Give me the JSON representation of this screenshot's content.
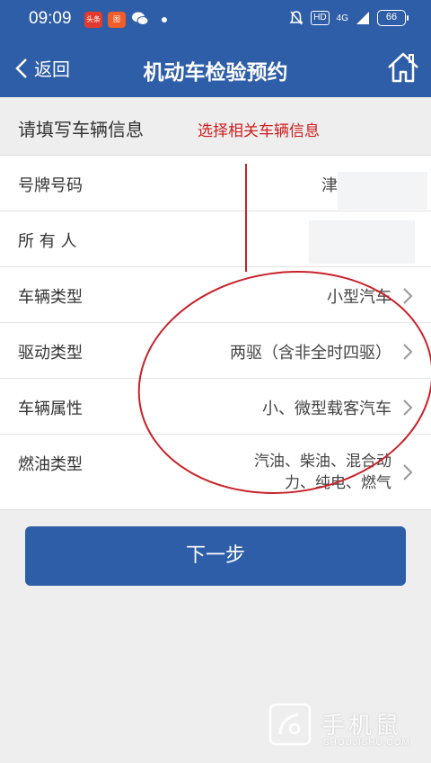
{
  "status_bar": {
    "time": "09:09",
    "app1": "头条",
    "app2": "图",
    "hd": "HD",
    "network": "4G",
    "battery": "66"
  },
  "nav": {
    "back_label": "返回",
    "title": "机动车检验预约"
  },
  "section": {
    "title": "请填写车辆信息",
    "annotation": "选择相关车辆信息"
  },
  "form": {
    "rows": [
      {
        "label": "号牌号码",
        "value": "津"
      },
      {
        "label": "所 有 人",
        "value": ""
      },
      {
        "label": "车辆类型",
        "value": "小型汽车"
      },
      {
        "label": "驱动类型",
        "value": "两驱（含非全时四驱）"
      },
      {
        "label": "车辆属性",
        "value": "小、微型载客汽车"
      },
      {
        "label": "燃油类型",
        "value_line1": "汽油、柴油、混合动",
        "value_line2": "力、纯电、燃气"
      }
    ]
  },
  "next_button": {
    "label": "下一步"
  },
  "watermark": {
    "brand": "手机鼠",
    "url": "SHOUJISHU.COM"
  },
  "colors": {
    "primary": "#2f5ea8",
    "annotation_red": "#d01c1c",
    "background": "#eeeeee"
  }
}
